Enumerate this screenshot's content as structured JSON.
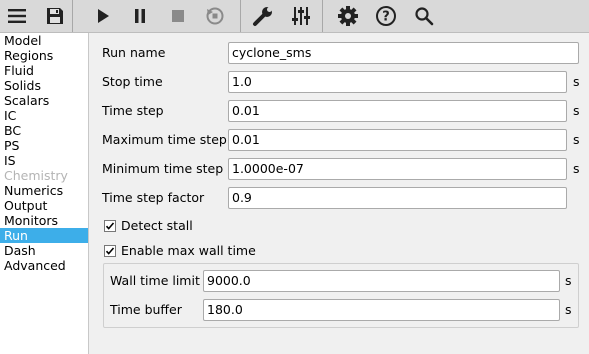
{
  "toolbar": {
    "icons": [
      "menu-icon",
      "save-icon",
      "play-icon",
      "pause-icon",
      "stop-icon",
      "reset-icon",
      "wrench-icon",
      "sliders-icon",
      "gear-icon",
      "help-icon",
      "search-icon"
    ]
  },
  "nav": {
    "items": [
      {
        "label": "Model",
        "state": "normal"
      },
      {
        "label": "Regions",
        "state": "normal"
      },
      {
        "label": "Fluid",
        "state": "normal"
      },
      {
        "label": "Solids",
        "state": "normal"
      },
      {
        "label": "Scalars",
        "state": "normal"
      },
      {
        "label": "IC",
        "state": "normal"
      },
      {
        "label": "BC",
        "state": "normal"
      },
      {
        "label": "PS",
        "state": "normal"
      },
      {
        "label": "IS",
        "state": "normal"
      },
      {
        "label": "Chemistry",
        "state": "disabled"
      },
      {
        "label": "Numerics",
        "state": "normal"
      },
      {
        "label": "Output",
        "state": "normal"
      },
      {
        "label": "Monitors",
        "state": "normal"
      },
      {
        "label": "Run",
        "state": "selected"
      },
      {
        "label": "Dash",
        "state": "normal"
      },
      {
        "label": "Advanced",
        "state": "normal"
      }
    ]
  },
  "form": {
    "run_name": {
      "label": "Run name",
      "value": "cyclone_sms"
    },
    "stop_time": {
      "label": "Stop time",
      "value": "1.0",
      "unit": "s"
    },
    "time_step": {
      "label": "Time step",
      "value": "0.01",
      "unit": "s"
    },
    "max_time_step": {
      "label": "Maximum time step",
      "value": "0.01",
      "unit": "s"
    },
    "min_time_step": {
      "label": "Minimum time step",
      "value": "1.0000e-07",
      "unit": "s"
    },
    "time_step_factor": {
      "label": "Time step factor",
      "value": "0.9"
    },
    "detect_stall": {
      "label": "Detect stall",
      "checked": true
    },
    "enable_max_wall_time": {
      "label": "Enable max wall time",
      "checked": true
    },
    "wall_time_limit": {
      "label": "Wall time limit",
      "value": "9000.0",
      "unit": "s"
    },
    "time_buffer": {
      "label": "Time buffer",
      "value": "180.0",
      "unit": "s"
    }
  },
  "colors": {
    "selection": "#3daee9",
    "toolbar_bg": "#d9d9d9",
    "disabled_text": "#b4b4b4"
  }
}
